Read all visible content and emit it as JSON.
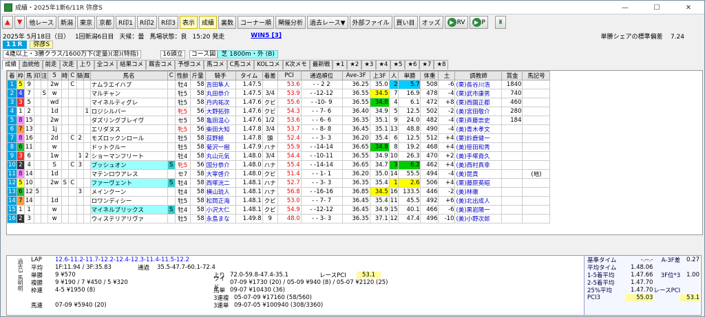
{
  "title": "成績・2025年1新6/11R 弥彦S",
  "window_controls": [
    "—",
    "☐",
    "✕"
  ],
  "toolbar": [
    "他レース",
    "新潟",
    "東京",
    "京都",
    "R印1",
    "R印2",
    "R印3",
    "表示",
    "成績",
    "裏数",
    "コーナー順",
    "閘催分析",
    "過去レース▼",
    "外部ファイル",
    "買い目",
    "オッズ",
    "RV",
    "P"
  ],
  "info": {
    "date": "2025年 5月18日（日）",
    "meet": "1回新潟6日目",
    "weather_label": "天候：",
    "weather": "曇",
    "track_label": "馬場状態：",
    "track": "良",
    "time": "15:20 発走",
    "win5": "WIN5 [3]",
    "share_label": "単勝シェアの標準偏差",
    "share": "7.24"
  },
  "race": {
    "no": "11R",
    "name": "弥彦S",
    "cond": "4歳以上・3勝クラス/1600万下(定量)(混)(特指)",
    "heads": "16頭立",
    "course_btn": "コース図",
    "surface": "芝 1800m・外 (B)"
  },
  "tabs": [
    "成績",
    "血統他",
    "前走",
    "次走",
    "上り",
    "全コメ",
    "結果コメ",
    "厩舎コメ",
    "予想コメ",
    "馬コメ",
    "C馬コメ",
    "KOLコメ",
    "K次メモ",
    "最新戦",
    "★1",
    "★2",
    "★3",
    "★4",
    "★5",
    "★6",
    "★7",
    "★8"
  ],
  "columns": [
    "着",
    "枠",
    "馬",
    "印",
    "注",
    "5",
    "時",
    "C",
    "騎",
    "厩",
    "馬名",
    "C",
    "性齢",
    "斤量",
    "騎手",
    "タイム",
    "着差",
    "PCI",
    "通過順位",
    "Ave-3F",
    "上3F",
    "人",
    "単勝",
    "体重",
    "土",
    "調教師",
    "賞金",
    "馬記号"
  ],
  "rows": [
    [
      "1",
      "5",
      "9",
      "",
      "",
      "2w",
      "",
      "C",
      "",
      "",
      "ナムラエイハブ",
      "",
      "牡4",
      "58",
      "吉田隼人",
      "1.47.5",
      "",
      "53.6",
      "- - 2 2",
      "36.25",
      "35.0",
      "2",
      "5.7",
      "508",
      "-6",
      "(栗)長谷川浩",
      "1840",
      ""
    ],
    [
      "2",
      "4",
      "7",
      "",
      "S",
      "w",
      "",
      "",
      "",
      "",
      "マルチャン",
      "",
      "牡5",
      "58",
      "丸田恭介",
      "1.47.5",
      "3/4",
      "53.9",
      "- -12-12",
      "36.55",
      "34.5",
      "7",
      "16.9",
      "478",
      "-4",
      "(栗)武市康男",
      "740",
      ""
    ],
    [
      "3",
      "3",
      "5",
      "",
      "",
      "wd",
      "",
      "",
      "",
      "",
      "マイネルティグレ",
      "",
      "牡5",
      "58",
      "丹内祐次",
      "1.47.6",
      "クビ",
      "55.6",
      "- -10- 9",
      "36.55",
      "34.8",
      "4",
      "6.1",
      "472",
      "+8",
      "(栗)西園正都",
      "460",
      ""
    ],
    [
      "4",
      "1",
      "2",
      "",
      "",
      "1d",
      "",
      "",
      "",
      "1",
      "ロジシルバー",
      "",
      "牝5",
      "56",
      "大野拓弥",
      "1.47.6",
      "クビ",
      "54.3",
      "- - 7- 6",
      "36.40",
      "34.9",
      "5",
      "12.5",
      "502",
      "-2",
      "(美)宮田敬介",
      "280",
      ""
    ],
    [
      "5",
      "8",
      "15",
      "",
      "",
      "2w",
      "",
      "",
      "",
      "",
      "ダズリングブレイヴ",
      "",
      "セ5",
      "58",
      "亀田温心",
      "1.47.6",
      "1/2",
      "53.6",
      "- - 6- 6",
      "36.35",
      "35.1",
      "9",
      "24.0",
      "482",
      "-4",
      "(栗)斉藤崇史",
      "184",
      ""
    ],
    [
      "6",
      "7",
      "13",
      "",
      "",
      "1j",
      "",
      "",
      "",
      "",
      "エリダヌス",
      "",
      "牝5",
      "56",
      "柴田大知",
      "1.47.8",
      "3/4",
      "53.7",
      "- - 8- 8",
      "36.45",
      "35.1",
      "13",
      "48.8",
      "490",
      "-4",
      "(美)青木孝文",
      "",
      ""
    ],
    [
      "7",
      "8",
      "16",
      "",
      "",
      "2d",
      "",
      "C",
      "2",
      "",
      "モズロックンロール",
      "",
      "牡5",
      "58",
      "荻野極",
      "1.47.8",
      "頭",
      "52.4",
      "- - 3- 3",
      "36.20",
      "35.4",
      "6",
      "12.5",
      "512",
      "+4",
      "(栗)鈴鹿健一",
      "",
      ""
    ],
    [
      "8",
      "6",
      "11",
      "",
      "",
      "w",
      "",
      "",
      "",
      "",
      "ドットクルー",
      "",
      "牡5",
      "58",
      "菊沢一樹",
      "1.47.9",
      "ハナ",
      "55.9",
      "- -14-14",
      "36.65",
      "34.8",
      "8",
      "19.2",
      "468",
      "+4",
      "(美)笹田和秀",
      "",
      ""
    ],
    [
      "9",
      "3",
      "6",
      "",
      "",
      "1w",
      "",
      "",
      "1",
      "2",
      "ショーマンフリート",
      "",
      "牡4",
      "58",
      "丸山元気",
      "1.48.0",
      "3/4",
      "54.4",
      "- -10-11",
      "36.55",
      "34.9",
      "10",
      "26.3",
      "470",
      "+2",
      "(美)手塚貴久",
      "",
      ""
    ],
    [
      "10",
      "2",
      "4",
      "",
      "",
      "S",
      "",
      "C",
      "3",
      "",
      "ブッシュオン",
      "S",
      "牝5",
      "56",
      "国分恭介",
      "1.48.0",
      "ハナ",
      "55.4",
      "- -14-14",
      "36.65",
      "34.7",
      "3",
      "6.2",
      "462",
      "+4",
      "(美)西村真幸",
      "",
      ""
    ],
    [
      "11",
      "8",
      "14",
      "",
      "",
      "1d",
      "",
      "",
      "",
      "",
      "マテンロウアレス",
      "",
      "セ7",
      "58",
      "大宰啓介",
      "1.48.0",
      "クビ",
      "51.4",
      "- - 1- 1",
      "36.20",
      "35.0",
      "14",
      "55.5",
      "494",
      "-4",
      "(美)昆貢",
      "",
      "(地)"
    ],
    [
      "12",
      "5",
      "10",
      "",
      "",
      "2w",
      "S",
      "C",
      "",
      "",
      "ファーヴェント",
      "S",
      "牡4",
      "58",
      "西塚洸二",
      "1.48.1",
      "ハナ",
      "52.7",
      "- - 3- 3",
      "36.35",
      "35.4",
      "1",
      "2.6",
      "506",
      "+4",
      "(栗)藤原英昭",
      "",
      ""
    ],
    [
      "13",
      "6",
      "12",
      "5",
      "",
      "",
      "",
      "",
      "3",
      "",
      "メインクーン",
      "",
      "牡4",
      "58",
      "横山琉人",
      "1.48.1",
      "ハナ",
      "56.8",
      "- -16-16",
      "36.85",
      "34.5",
      "16",
      "133.5",
      "446",
      "-2",
      "(美)林徹",
      "",
      ""
    ],
    [
      "14",
      "7",
      "14",
      "",
      "",
      "1d",
      "",
      "",
      "",
      "",
      "ロワンディシー",
      "",
      "牡5",
      "58",
      "松岡正海",
      "1.48.1",
      "クビ",
      "53.0",
      "- - 7- 7",
      "36.45",
      "35.4",
      "11",
      "45.5",
      "492",
      "+6",
      "(美)北出成人",
      "",
      ""
    ],
    [
      "15",
      "1",
      "1",
      "",
      "",
      "w",
      "",
      "",
      "",
      "",
      "マイネルブリックス",
      "S",
      "牡4",
      "58",
      "小沢大仁",
      "1.48.1",
      "クビ",
      "54.9",
      "- -12-12",
      "36.45",
      "34.9",
      "15",
      "40.1",
      "466",
      "-6",
      "(美)黒岩陽一",
      "",
      ""
    ],
    [
      "16",
      "2",
      "3",
      "",
      "",
      "w",
      "",
      "",
      "",
      "",
      "ウィステリアリヴァ",
      "",
      "牡5",
      "58",
      "永島まな",
      "1.49.8",
      "9",
      "48.0",
      "- - 3- 3",
      "36.35",
      "37.1",
      "12",
      "47.4",
      "496",
      "-10",
      "(美)小野次郎",
      "",
      ""
    ]
  ],
  "bottom": {
    "tab_labels": "過去3 馬明明",
    "lap_label": "LAP",
    "lap": "12.6-11.2-11.7-12.2-12.4-12.3-11.4-11.5-12.2",
    "avg_label": "平均",
    "avg": "1F:11.94 / 3F:35.83",
    "pass_label": "通過",
    "pass": "35.5-47.7-60.1-72.4",
    "agari_label": "上り",
    "agari": "72.0-59.8-47.4-35.1",
    "pci_label": "レースPCI",
    "pci": "53.1",
    "tansho_label": "単勝",
    "tansho": "9 ¥570",
    "fukusho_label": "複勝",
    "fukusho": "9 ¥190 / 7 ¥450 / 5 ¥320",
    "wakuren_label": "枠連",
    "wakuren": "4-5 ¥1950 (8)",
    "umaren_label": "馬連",
    "umaren": "07-09 ¥5940 (20)",
    "wide_label": "ワイド",
    "wide": "07-09 ¥1730 (20) / 05-09 ¥940 (8) / 05-07 ¥2120 (25)",
    "umatan_label": "馬単",
    "umatan": "09-07 ¥10430 (36)",
    "sanrenpuku_label": "3連複",
    "sanrenpuku": "05-07-09 ¥17160 (58/560)",
    "sanrentan_label": "3連単",
    "sanrentan": "09-07-05 ¥100940 (308/3360)"
  },
  "stats": [
    {
      "k": "基準タイム",
      "v": "-.--.-",
      "k2": "A-3F差",
      "v2": "0.27"
    },
    {
      "k": "平均タイム",
      "v": "1.48.06",
      "k2": "",
      "v2": ""
    },
    {
      "k": "1-5着平均",
      "v": "1.47.66",
      "k2": "3F位*3",
      "v2": "1.00"
    },
    {
      "k": "2-5着平均",
      "v": "1.47.70",
      "k2": "",
      "v2": ""
    },
    {
      "k": "25%平均",
      "v": "1.47.70",
      "k2": "レースPCI",
      "v2": ""
    },
    {
      "k": "PCI3",
      "v": "55.03",
      "k2": "",
      "v2": "53.1"
    }
  ]
}
